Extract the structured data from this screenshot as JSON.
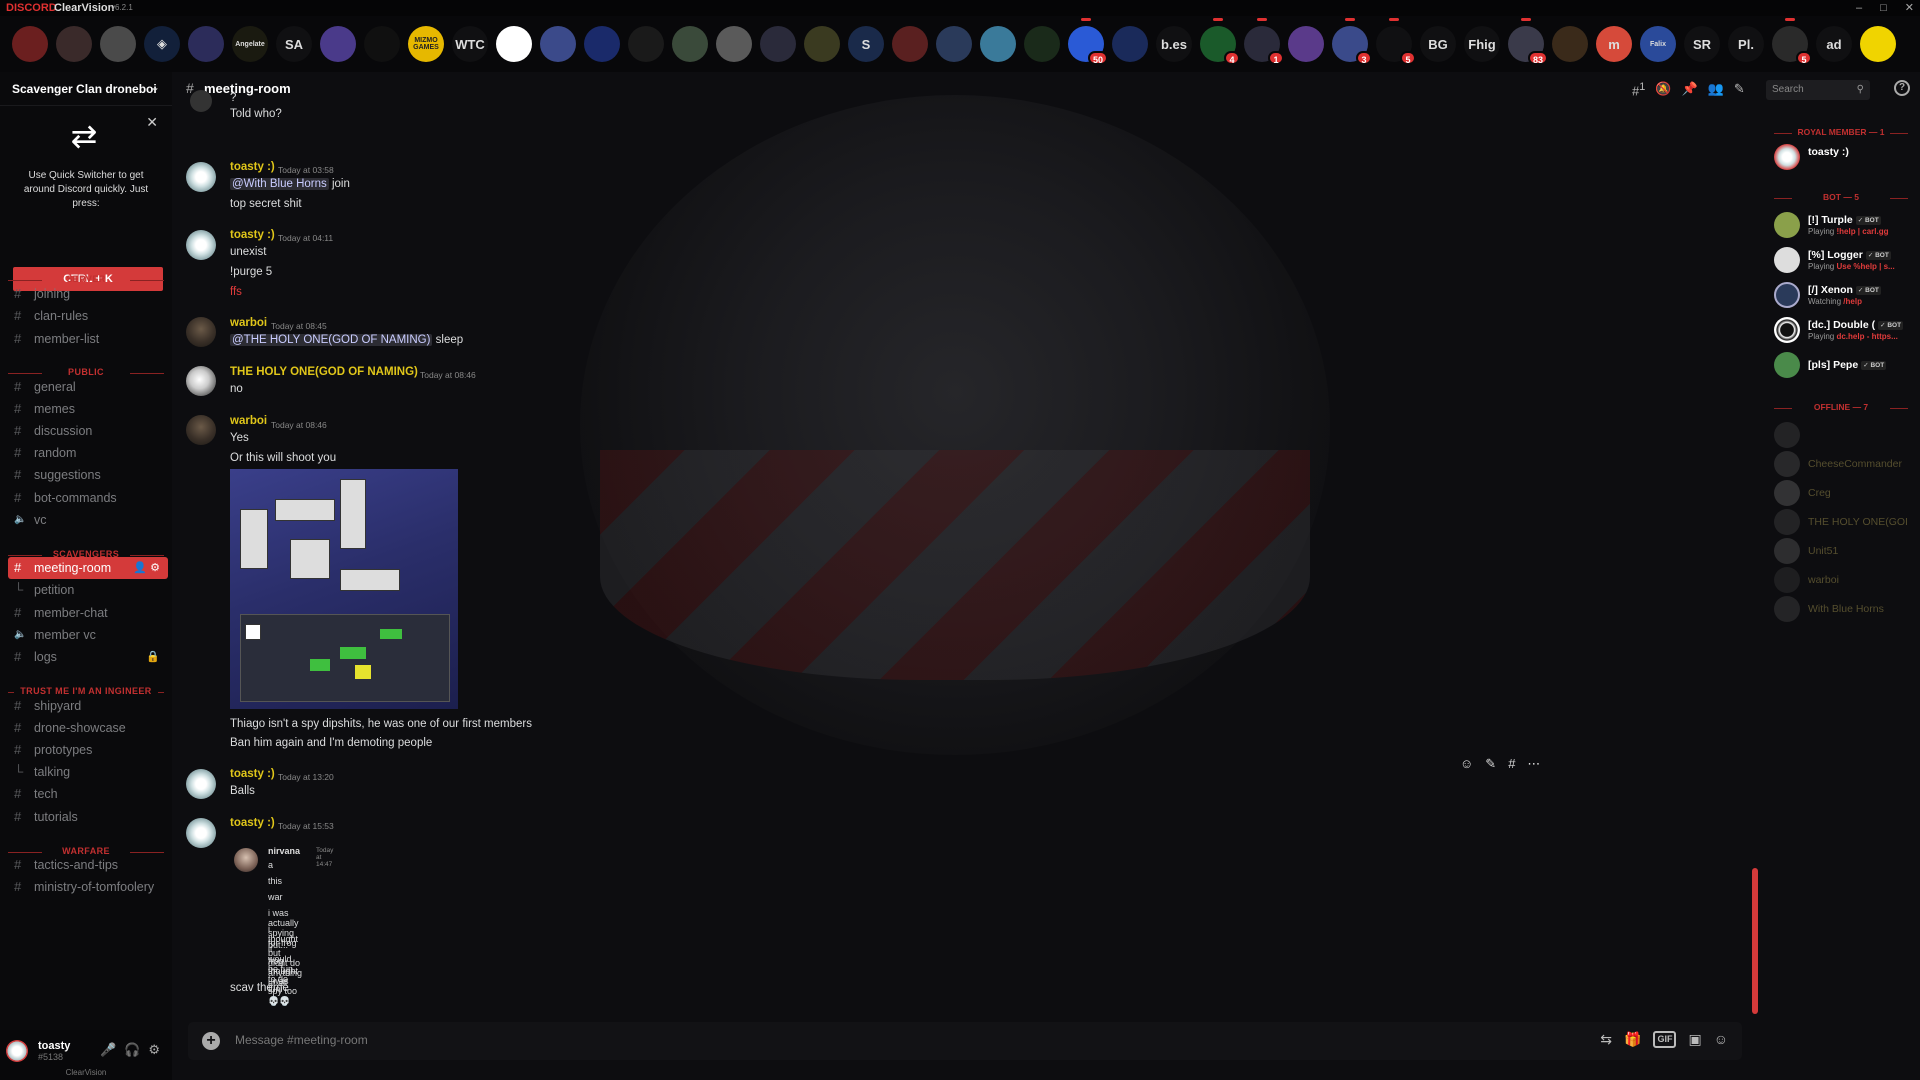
{
  "titlebar": {
    "brand": "DISCORD",
    "app": "ClearVision",
    "version": "v6.2.1",
    "controls": [
      "–",
      "□",
      "✕"
    ]
  },
  "servers": [
    {
      "label": "",
      "color": "#6b1f1f"
    },
    {
      "label": "",
      "color": "#3a2a2a"
    },
    {
      "label": "",
      "color": "#4a4a4a"
    },
    {
      "label": "◈",
      "color": "#12203a"
    },
    {
      "label": "",
      "color": "#2c2c5a"
    },
    {
      "label": "Angelate",
      "color": "#1a1a10"
    },
    {
      "label": "SA",
      "color": "#101012"
    },
    {
      "label": "",
      "color": "#4a3a8a"
    },
    {
      "label": "",
      "color": "#101010"
    },
    {
      "label": "MIZMO GAMES",
      "color": "#e6b800"
    },
    {
      "label": "WTC",
      "color": "#101012"
    },
    {
      "label": "",
      "color": "#ffffff"
    },
    {
      "label": "",
      "color": "#3b4a8a"
    },
    {
      "label": "",
      "color": "#1a2a6a"
    },
    {
      "label": "",
      "color": "#1a1a1a"
    },
    {
      "label": "",
      "color": "#3a4a3a"
    },
    {
      "label": "",
      "color": "#5a5a5a"
    },
    {
      "label": "",
      "color": "#2a2a3a"
    },
    {
      "label": "",
      "color": "#3a3a20"
    },
    {
      "label": "S",
      "color": "#1a2a4a"
    },
    {
      "label": "",
      "color": "#5a2020"
    },
    {
      "label": "",
      "color": "#2a3a5a"
    },
    {
      "label": "",
      "color": "#3a7a9a"
    },
    {
      "label": "",
      "color": "#1a2a1a"
    },
    {
      "label": "",
      "color": "#2a5ad6",
      "badge": "50"
    },
    {
      "label": "",
      "color": "#1a2a5a"
    },
    {
      "label": "b.es",
      "color": "#101012"
    },
    {
      "label": "",
      "color": "#1a5a2a",
      "badge": "4"
    },
    {
      "label": "",
      "color": "#2a2a3a",
      "badge": "1"
    },
    {
      "label": "",
      "color": "#5a3a8a"
    },
    {
      "label": "",
      "color": "#3a4a8a",
      "badge": "3"
    },
    {
      "label": "",
      "color": "#101012",
      "badge": "5"
    },
    {
      "label": "BG",
      "color": "#101012"
    },
    {
      "label": "Fhig",
      "color": "#101012"
    },
    {
      "label": "",
      "color": "#3a3a4a",
      "badge": "83"
    },
    {
      "label": "",
      "color": "#3a2a1a"
    },
    {
      "label": "m",
      "color": "#d64a3a"
    },
    {
      "label": "Falix",
      "color": "#2a4a9a"
    },
    {
      "label": "SR",
      "color": "#101012"
    },
    {
      "label": "Pl.",
      "color": "#101012"
    },
    {
      "label": "",
      "color": "#2a2a2a",
      "badge": "5"
    },
    {
      "label": "ad",
      "color": "#101012"
    },
    {
      "label": "",
      "color": "#f0d400"
    }
  ],
  "server": {
    "name": "Scavenger Clan droneboi"
  },
  "quick_switcher": {
    "text": "Use Quick Switcher to get around Discord quickly. Just press:",
    "button": "CTRL + K"
  },
  "categories": [
    {
      "name": "SERVER",
      "channels": [
        {
          "name": "joining"
        },
        {
          "name": "clan-rules"
        },
        {
          "name": "member-list"
        }
      ]
    },
    {
      "name": "PUBLIC",
      "channels": [
        {
          "name": "general"
        },
        {
          "name": "memes"
        },
        {
          "name": "discussion"
        },
        {
          "name": "random"
        },
        {
          "name": "suggestions"
        },
        {
          "name": "bot-commands"
        },
        {
          "name": "vc",
          "type": "voice"
        }
      ]
    },
    {
      "name": "SCAVENGERS",
      "channels": [
        {
          "name": "meeting-room",
          "active": true
        },
        {
          "name": "petition",
          "type": "thread"
        },
        {
          "name": "member-chat"
        },
        {
          "name": "member vc",
          "type": "voice"
        },
        {
          "name": "logs",
          "locked": true
        }
      ]
    },
    {
      "name": "TRUST ME I'M AN INGINEER",
      "channels": [
        {
          "name": "shipyard"
        },
        {
          "name": "drone-showcase"
        },
        {
          "name": "prototypes"
        },
        {
          "name": "talking",
          "type": "thread"
        },
        {
          "name": "tech"
        },
        {
          "name": "tutorials"
        }
      ]
    },
    {
      "name": "WARFARE",
      "channels": [
        {
          "name": "tactics-and-tips"
        },
        {
          "name": "ministry-of-tomfoolery"
        }
      ]
    }
  ],
  "user": {
    "name": "toasty",
    "tag": "#5138",
    "brand": "ClearVision"
  },
  "channel": {
    "name": "meeting-room",
    "thread_count": "1"
  },
  "search": {
    "placeholder": "Search"
  },
  "messages": [
    {
      "lines": [
        "?",
        "Told who?"
      ]
    },
    {
      "author": "toasty :)",
      "time": "Today at 03:58",
      "mention": "@With Blue Horns",
      "after": " join",
      "lines": [
        "top secret shit"
      ]
    },
    {
      "author": "toasty :)",
      "time": "Today at 04:11",
      "lines": [
        "unexist",
        "!purge 5"
      ],
      "red": "ffs"
    },
    {
      "author": "warboi",
      "time": "Today at 08:45",
      "mention": "@THE HOLY ONE(GOD OF NAMING)",
      "after": " sleep"
    },
    {
      "author": "THE HOLY ONE(GOD OF NAMING)",
      "time": "Today at 08:46",
      "lines": [
        "no"
      ]
    },
    {
      "author": "warboi",
      "time": "Today at 08:46",
      "lines": [
        "Yes",
        "Or this will shoot you",
        "Thiago isn't a spy dipshits, he was one of our first members",
        "Ban him again and I'm demoting people"
      ]
    },
    {
      "author": "toasty :)",
      "time": "Today at 13:20",
      "lines": [
        "Balls"
      ]
    },
    {
      "author": "toasty :)",
      "time": "Today at 15:53",
      "lines": [
        "scav theme"
      ]
    }
  ],
  "quote": {
    "author": "nirvana",
    "time": "Today at 14:47",
    "lines": [
      "a",
      "this",
      "war",
      "i was actually spying for frog but didnt do anything at all",
      "i thought it would be fun to do funi",
      "but...",
      "frog thought i was spy too 💀💀"
    ]
  },
  "input": {
    "placeholder": "Message #meeting-room"
  },
  "members": {
    "royal": {
      "title": "ROYAL MEMBER — 1",
      "list": [
        {
          "name": "toasty :)"
        }
      ]
    },
    "bots": {
      "title": "BOT — 5",
      "list": [
        {
          "name": "[!] Turple",
          "activity_prefix": "Playing ",
          "activity": "!help | carl.gg"
        },
        {
          "name": "[%] Logger",
          "activity_prefix": "Playing ",
          "activity": "Use %help | s..."
        },
        {
          "name": "[/] Xenon",
          "activity_prefix": "Watching ",
          "activity": "/help"
        },
        {
          "name": "[dc.] Double (",
          "activity_prefix": "Playing ",
          "activity": "dc.help - https..."
        },
        {
          "name": "[pls] Pepe",
          "activity_prefix": "",
          "activity": ""
        }
      ],
      "tag": "✓ BOT"
    },
    "offline": {
      "title": "OFFLINE — 7",
      "list": [
        {
          "name": ""
        },
        {
          "name": "CheeseCommander"
        },
        {
          "name": "Creg"
        },
        {
          "name": "THE HOLY ONE(GOI"
        },
        {
          "name": "Unit51"
        },
        {
          "name": "warboi"
        },
        {
          "name": "With Blue Horns"
        }
      ]
    }
  },
  "colors": {
    "accent": "#d43a3a",
    "username": "#e0c61a",
    "background": "#0d0d10"
  }
}
